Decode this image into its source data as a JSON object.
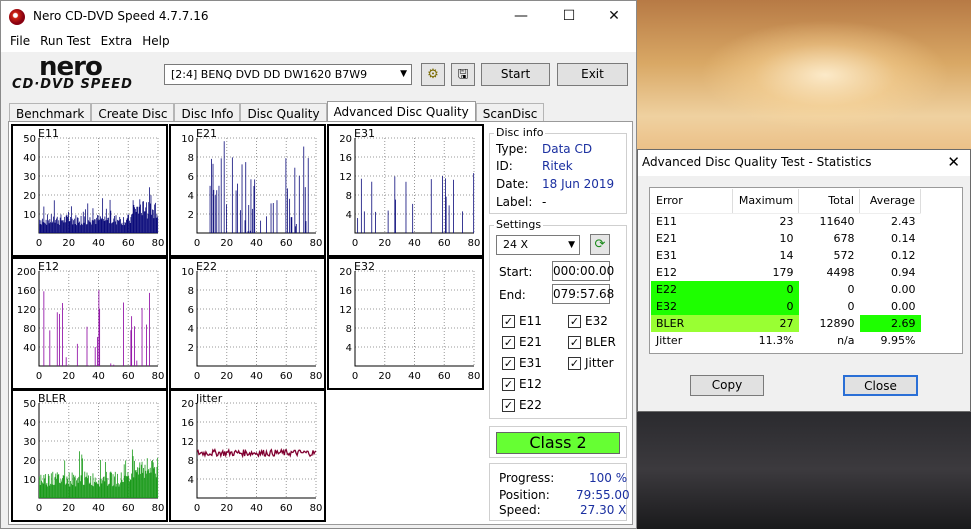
{
  "window": {
    "title": "Nero CD-DVD Speed 4.7.7.16",
    "minimize": "—",
    "maximize": "☐",
    "close": "✕"
  },
  "menu": [
    "File",
    "Run Test",
    "Extra",
    "Help"
  ],
  "logo": {
    "brand": "nero",
    "subtitle": "CD·DVD SPEED"
  },
  "toolbar": {
    "drive": "[2:4]   BENQ DVD DD DW1620 B7W9",
    "start": "Start",
    "exit": "Exit"
  },
  "tabs": [
    "Benchmark",
    "Create Disc",
    "Disc Info",
    "Disc Quality",
    "Advanced Disc Quality",
    "ScanDisc"
  ],
  "active_tab": "Advanced Disc Quality",
  "disc_info": {
    "header": "Disc info",
    "type_label": "Type:",
    "type": "Data CD",
    "id_label": "ID:",
    "id": "Ritek",
    "date_label": "Date:",
    "date": "18 Jun 2019",
    "label_label": "Label:",
    "label": "-"
  },
  "settings": {
    "header": "Settings",
    "speed": "24 X",
    "start_label": "Start:",
    "start": "000:00.00",
    "end_label": "End:",
    "end": "079:57.68",
    "checks_left": [
      "E11",
      "E21",
      "E31",
      "E12",
      "E22"
    ],
    "checks_right": [
      "E32",
      "BLER",
      "Jitter"
    ]
  },
  "class": "Class 2",
  "progress": {
    "progress_label": "Progress:",
    "progress": "100 %",
    "position_label": "Position:",
    "position": "79:55.00",
    "speed_label": "Speed:",
    "speed": "27.30 X"
  },
  "colors": {
    "navy": "#0a0a7a",
    "purple": "#8a00a0",
    "green": "#1a9a1a",
    "maroon": "#800030",
    "class_bg": "#66ff33"
  },
  "chart_data": [
    {
      "name": "E11",
      "type": "bar",
      "title": "E11",
      "xlim": [
        0,
        80
      ],
      "ylim": [
        0,
        50
      ],
      "xticks": [
        "0",
        "20",
        "40",
        "60",
        "80"
      ],
      "yticks": [
        "10",
        "20",
        "30",
        "40",
        "50"
      ],
      "color": "#0a0a7a",
      "pattern": "dense",
      "values_note": "peaks ~23"
    },
    {
      "name": "E21",
      "type": "bar",
      "title": "E21",
      "xlim": [
        0,
        80
      ],
      "ylim": [
        0,
        10
      ],
      "xticks": [
        "0",
        "20",
        "40",
        "60",
        "80"
      ],
      "yticks": [
        "2",
        "4",
        "6",
        "8",
        "10"
      ],
      "color": "#0a0a7a"
    },
    {
      "name": "E31",
      "type": "bar",
      "title": "E31",
      "xlim": [
        0,
        80
      ],
      "ylim": [
        0,
        20
      ],
      "xticks": [
        "0",
        "20",
        "40",
        "60",
        "80"
      ],
      "yticks": [
        "4",
        "8",
        "12",
        "16",
        "20"
      ],
      "color": "#0a0a7a"
    },
    {
      "name": "E12",
      "type": "bar",
      "title": "E12",
      "xlim": [
        0,
        80
      ],
      "ylim": [
        0,
        200
      ],
      "xticks": [
        "0",
        "20",
        "40",
        "60",
        "80"
      ],
      "yticks": [
        "40",
        "80",
        "120",
        "160",
        "200"
      ],
      "color": "#8a00a0"
    },
    {
      "name": "E22",
      "type": "bar",
      "title": "E22",
      "xlim": [
        0,
        80
      ],
      "ylim": [
        0,
        10
      ],
      "xticks": [
        "0",
        "20",
        "40",
        "60",
        "80"
      ],
      "yticks": [
        "2",
        "4",
        "6",
        "8",
        "10"
      ],
      "color": "#8a00a0"
    },
    {
      "name": "E32",
      "type": "bar",
      "title": "E32",
      "xlim": [
        0,
        80
      ],
      "ylim": [
        0,
        20
      ],
      "xticks": [
        "0",
        "20",
        "40",
        "60",
        "80"
      ],
      "yticks": [
        "4",
        "8",
        "12",
        "16",
        "20"
      ],
      "color": "#8a00a0"
    },
    {
      "name": "BLER",
      "type": "bar",
      "title": "BLER",
      "xlim": [
        0,
        80
      ],
      "ylim": [
        0,
        50
      ],
      "xticks": [
        "0",
        "20",
        "40",
        "60",
        "80"
      ],
      "yticks": [
        "10",
        "20",
        "30",
        "40",
        "50"
      ],
      "color": "#1a9a1a"
    },
    {
      "name": "Jitter",
      "type": "line",
      "title": "Jitter",
      "xlim": [
        0,
        80
      ],
      "ylim": [
        0,
        20
      ],
      "xticks": [
        "0",
        "20",
        "40",
        "60",
        "80"
      ],
      "yticks": [
        "4",
        "8",
        "12",
        "16",
        "20"
      ],
      "color": "#800030"
    }
  ],
  "stats": {
    "title": "Advanced Disc Quality Test - Statistics",
    "headers": [
      "Error",
      "Maximum",
      "Total",
      "Average"
    ],
    "rows": [
      [
        "E11",
        "23",
        "11640",
        "2.43"
      ],
      [
        "E21",
        "10",
        "678",
        "0.14"
      ],
      [
        "E31",
        "14",
        "572",
        "0.12"
      ],
      [
        "E12",
        "179",
        "4498",
        "0.94"
      ],
      [
        "E22",
        "0",
        "0",
        "0.00"
      ],
      [
        "E32",
        "0",
        "0",
        "0.00"
      ],
      [
        "BLER",
        "27",
        "12890",
        "2.69"
      ],
      [
        "Jitter",
        "11.3%",
        "n/a",
        "9.95%"
      ]
    ],
    "copy": "Copy",
    "close": "Close"
  }
}
